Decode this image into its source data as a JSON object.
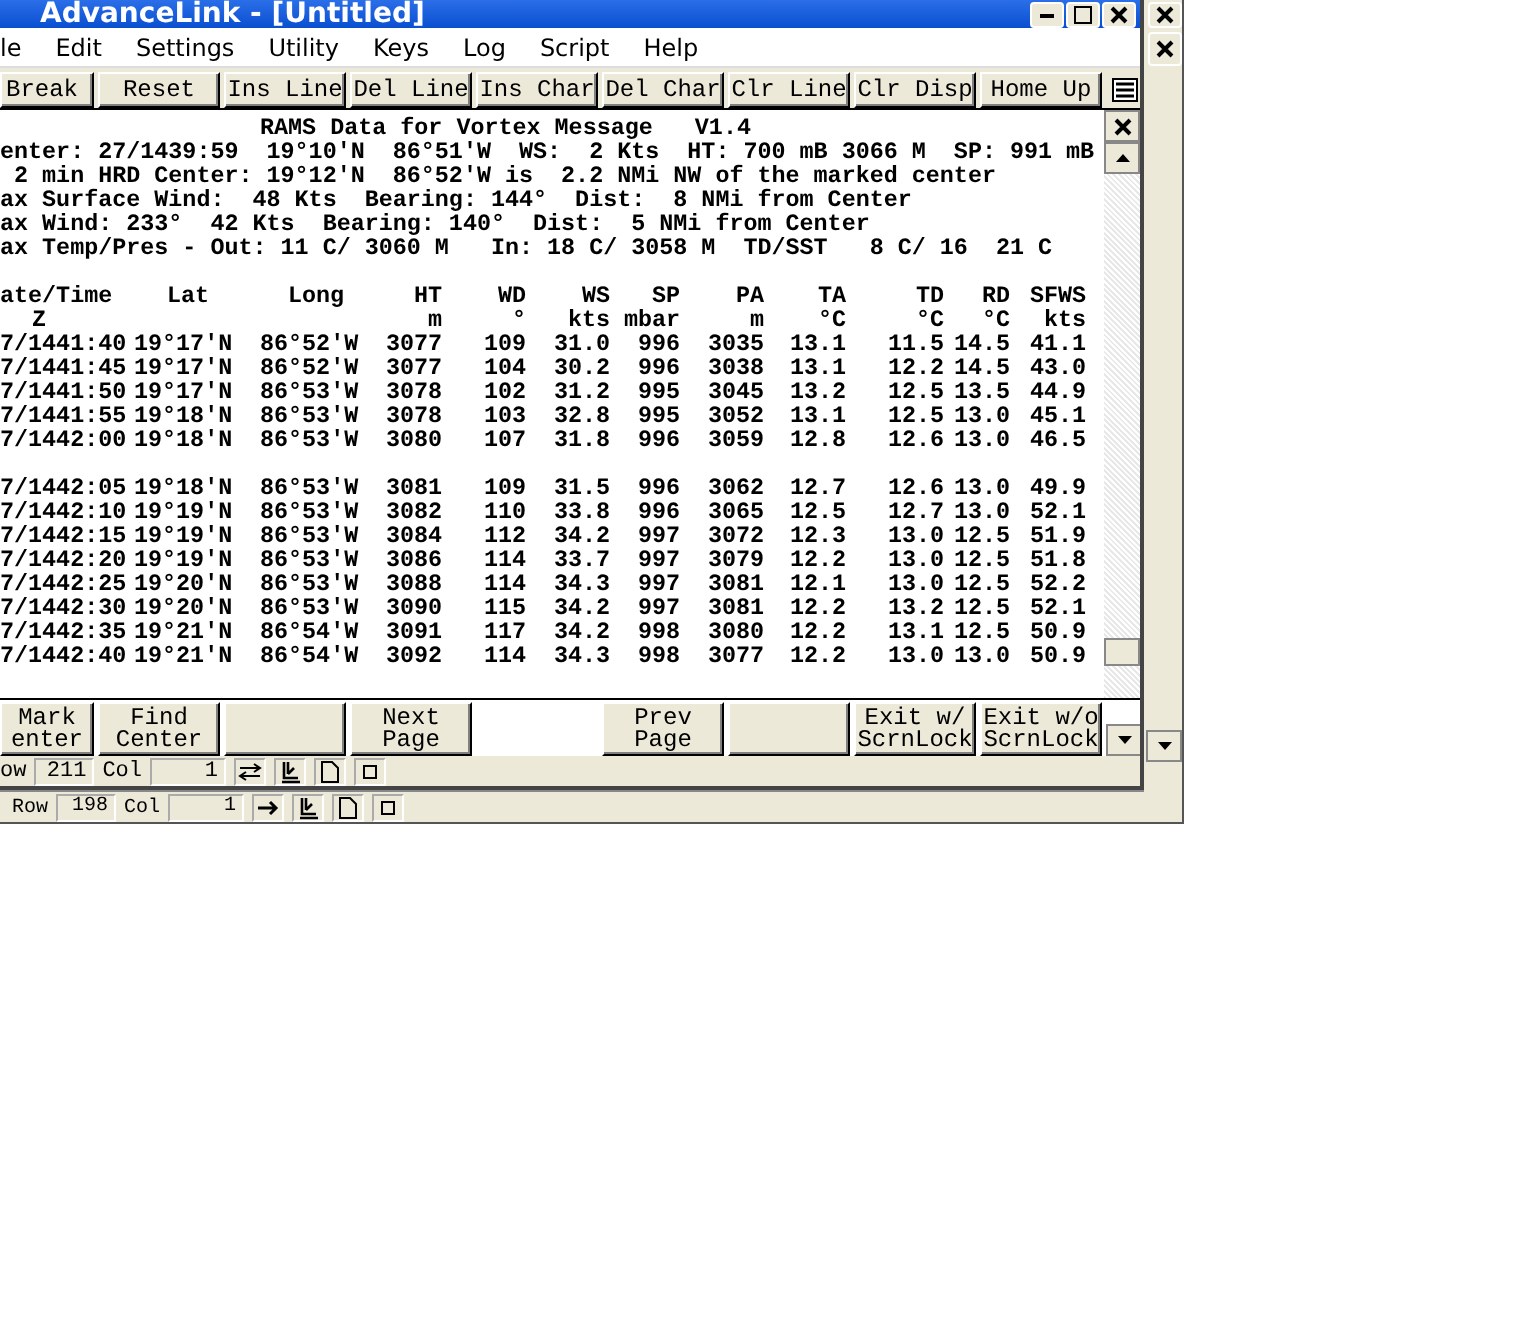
{
  "window": {
    "title": "AdvanceLink - [Untitled]"
  },
  "menu": [
    "le",
    "Edit",
    "Settings",
    "Utility",
    "Keys",
    "Log",
    "Script",
    "Help"
  ],
  "top_keys": [
    {
      "label": "Break"
    },
    {
      "label": "Reset"
    },
    {
      "label": "Ins Line"
    },
    {
      "label": "Del Line"
    },
    {
      "label": "Ins Char"
    },
    {
      "label": "Del Char"
    },
    {
      "label": "Clr Line"
    },
    {
      "label": "Clr Disp"
    },
    {
      "label": "Home Up"
    }
  ],
  "report": {
    "title": "RAMS Data for Vortex Message   V1.4",
    "lines": [
      "enter: 27/1439:59  19°10'N  86°51'W  WS:  2 Kts  HT: 700 mB 3066 M  SP: 991 mB",
      " 2 min HRD Center: 19°12'N  86°52'W is  2.2 NMi NW of the marked center",
      "ax Surface Wind:  48 Kts  Bearing: 144°  Dist:  8 NMi from Center",
      "ax Wind: 233°  42 Kts  Bearing: 140°  Dist:  5 NMi from Center",
      "ax Temp/Pres - Out: 11 C/ 3060 M   In: 18 C/ 3058 M  TD/SST   8 C/ 16  21 C"
    ]
  },
  "table": {
    "columns": [
      {
        "name": "ate/Time",
        "unit": "Z"
      },
      {
        "name": "Lat"
      },
      {
        "name": "Long"
      },
      {
        "name": "HT",
        "unit": "m"
      },
      {
        "name": "WD",
        "unit": "°"
      },
      {
        "name": "WS",
        "unit": "kts"
      },
      {
        "name": "SP",
        "unit": "mbar"
      },
      {
        "name": "PA",
        "unit": "m"
      },
      {
        "name": "TA",
        "unit": "°C"
      },
      {
        "name": "TD",
        "unit": "°C"
      },
      {
        "name": "RD",
        "unit": "°C"
      },
      {
        "name": "SFWS",
        "unit": "kts"
      }
    ],
    "groups": [
      [
        [
          "7/1441:40",
          "19°17'N",
          "86°52'W",
          "3077",
          "109",
          "31.0",
          "996",
          "3035",
          "13.1",
          "11.5",
          "14.5",
          "41.1"
        ],
        [
          "7/1441:45",
          "19°17'N",
          "86°52'W",
          "3077",
          "104",
          "30.2",
          "996",
          "3038",
          "13.1",
          "12.2",
          "14.5",
          "43.0"
        ],
        [
          "7/1441:50",
          "19°17'N",
          "86°53'W",
          "3078",
          "102",
          "31.2",
          "995",
          "3045",
          "13.2",
          "12.5",
          "13.5",
          "44.9"
        ],
        [
          "7/1441:55",
          "19°18'N",
          "86°53'W",
          "3078",
          "103",
          "32.8",
          "995",
          "3052",
          "13.1",
          "12.5",
          "13.0",
          "45.1"
        ],
        [
          "7/1442:00",
          "19°18'N",
          "86°53'W",
          "3080",
          "107",
          "31.8",
          "996",
          "3059",
          "12.8",
          "12.6",
          "13.0",
          "46.5"
        ]
      ],
      [
        [
          "7/1442:05",
          "19°18'N",
          "86°53'W",
          "3081",
          "109",
          "31.5",
          "996",
          "3062",
          "12.7",
          "12.6",
          "13.0",
          "49.9"
        ],
        [
          "7/1442:10",
          "19°19'N",
          "86°53'W",
          "3082",
          "110",
          "33.8",
          "996",
          "3065",
          "12.5",
          "12.7",
          "13.0",
          "52.1"
        ],
        [
          "7/1442:15",
          "19°19'N",
          "86°53'W",
          "3084",
          "112",
          "34.2",
          "997",
          "3072",
          "12.3",
          "13.0",
          "12.5",
          "51.9"
        ],
        [
          "7/1442:20",
          "19°19'N",
          "86°53'W",
          "3086",
          "114",
          "33.7",
          "997",
          "3079",
          "12.2",
          "13.0",
          "12.5",
          "51.8"
        ],
        [
          "7/1442:25",
          "19°20'N",
          "86°53'W",
          "3088",
          "114",
          "34.3",
          "997",
          "3081",
          "12.1",
          "13.0",
          "12.5",
          "52.2"
        ],
        [
          "7/1442:30",
          "19°20'N",
          "86°53'W",
          "3090",
          "115",
          "34.2",
          "997",
          "3081",
          "12.2",
          "13.2",
          "12.5",
          "52.1"
        ],
        [
          "7/1442:35",
          "19°21'N",
          "86°54'W",
          "3091",
          "117",
          "34.2",
          "998",
          "3080",
          "12.2",
          "13.1",
          "12.5",
          "50.9"
        ],
        [
          "7/1442:40",
          "19°21'N",
          "86°54'W",
          "3092",
          "114",
          "34.3",
          "998",
          "3077",
          "12.2",
          "13.0",
          "13.0",
          "50.9"
        ]
      ]
    ]
  },
  "bottom_keys": [
    {
      "kind": "key",
      "lines": [
        "Mark",
        "enter"
      ]
    },
    {
      "kind": "key",
      "lines": [
        "Find",
        "Center"
      ]
    },
    {
      "kind": "blank"
    },
    {
      "kind": "key",
      "lines": [
        "Next",
        "Page"
      ]
    },
    {
      "kind": "gap"
    },
    {
      "kind": "key",
      "lines": [
        "Prev",
        "Page"
      ]
    },
    {
      "kind": "blank"
    },
    {
      "kind": "key",
      "lines": [
        "Exit w/",
        "ScrnLock"
      ]
    },
    {
      "kind": "key",
      "lines": [
        "Exit w/o",
        "ScrnLock"
      ]
    }
  ],
  "status_bar": {
    "row_label": "ow",
    "row": "211",
    "col_label": "Col",
    "col": "1"
  },
  "back_status_bar": {
    "row_label": "Row",
    "row": "198",
    "col_label": "Col",
    "col": "1"
  }
}
